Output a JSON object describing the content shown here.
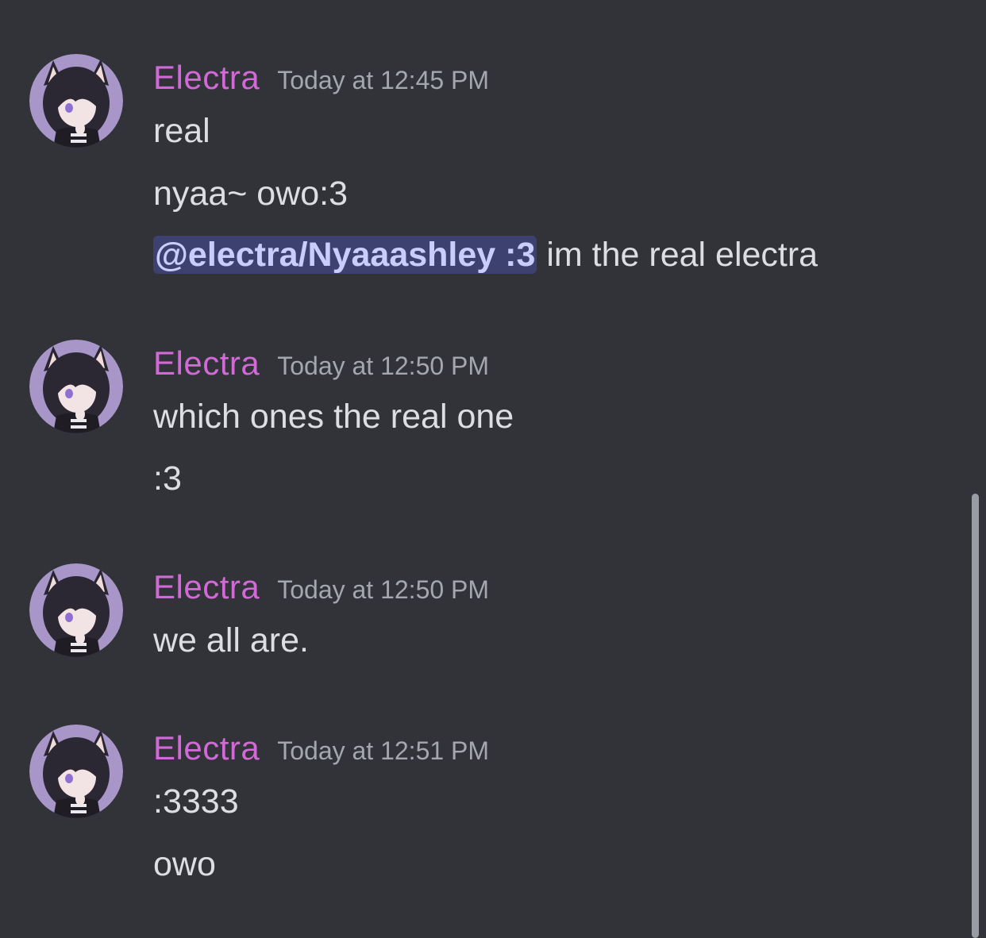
{
  "messages": [
    {
      "author": "Electra",
      "timestamp": "Today at 12:45 PM",
      "lines": [
        {
          "text": "real"
        },
        {
          "text": "nyaa~ owo:3"
        },
        {
          "mention": "@electra/Nyaaashley :3",
          "text": " im the real electra"
        }
      ]
    },
    {
      "author": "Electra",
      "timestamp": "Today at 12:50 PM",
      "lines": [
        {
          "text": "which ones the real one"
        },
        {
          "text": ":3"
        }
      ]
    },
    {
      "author": "Electra",
      "timestamp": "Today at 12:50 PM",
      "lines": [
        {
          "text": "we all are."
        }
      ]
    },
    {
      "author": "Electra",
      "timestamp": "Today at 12:51 PM",
      "lines": [
        {
          "text": ":3333"
        },
        {
          "text": "owo"
        }
      ]
    }
  ],
  "colors": {
    "background": "#313338",
    "username": "#d169d6",
    "timestamp": "#a4a7ae",
    "message_text": "#dcdee3",
    "mention_bg": "#3c4170",
    "mention_text": "#c9cdfb"
  }
}
